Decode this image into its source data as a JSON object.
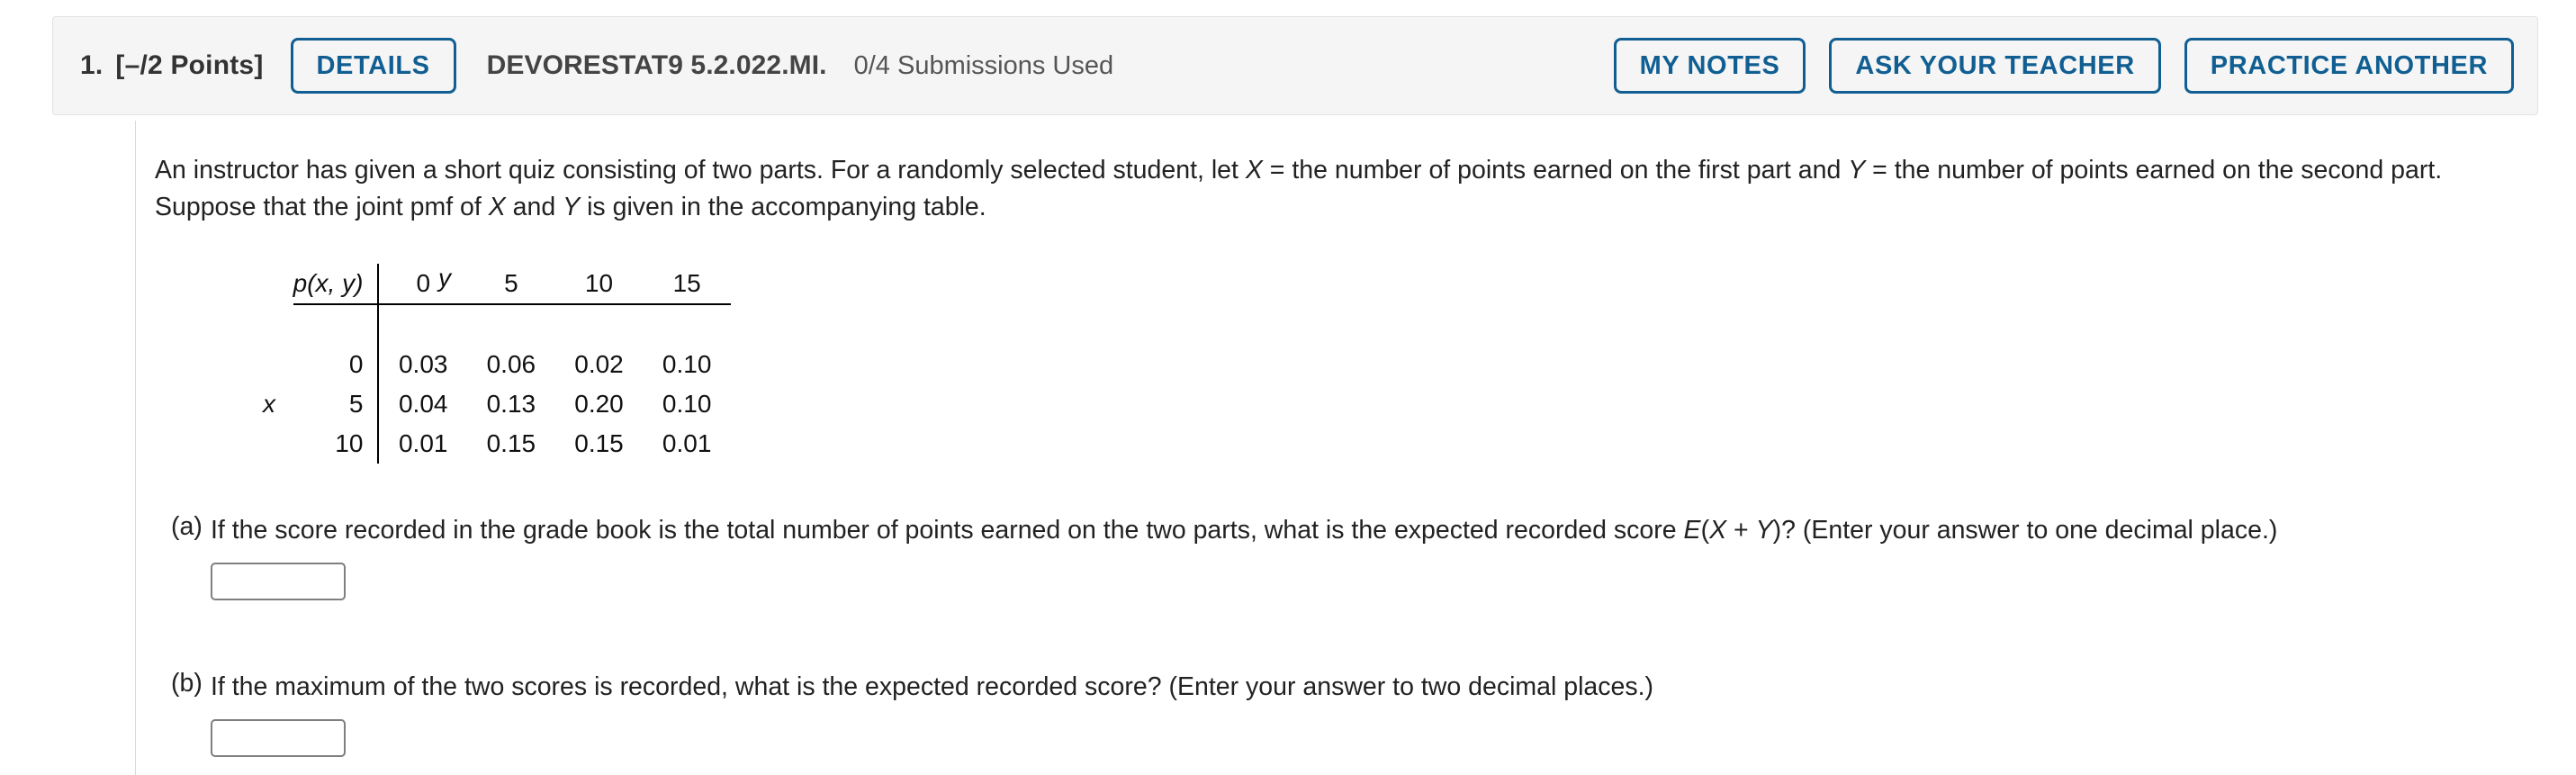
{
  "header": {
    "question_number": "1.",
    "points_label": "[–/2 Points]",
    "details_button": "DETAILS",
    "module_code": "DEVORESTAT9 5.2.022.MI.",
    "submissions_used": "0/4 Submissions Used",
    "my_notes_button": "MY NOTES",
    "ask_teacher_button": "ASK YOUR TEACHER",
    "practice_another_button": "PRACTICE ANOTHER",
    "accent_color": "#115f92",
    "background_color": "#f5f5f5"
  },
  "problem": {
    "text_part_1": "An instructor has given a short quiz consisting of two parts. For a randomly selected student, let ",
    "var_x_1": "X",
    "text_part_2": " = the number of points earned on the first part and ",
    "var_y_1": "Y",
    "text_part_3": " = the number of points earned on the second part. Suppose that the joint pmf of ",
    "var_x_2": "X",
    "text_part_4": " and ",
    "var_y_2": "Y",
    "text_part_5": " is given in the accompanying table."
  },
  "pmf_table": {
    "y_axis_label": "y",
    "x_axis_label": "x",
    "corner_label": "p(x, y)",
    "column_headers": [
      "0",
      "5",
      "10",
      "15"
    ],
    "row_headers": [
      "0",
      "5",
      "10"
    ],
    "values": [
      [
        "0.03",
        "0.06",
        "0.02",
        "0.10"
      ],
      [
        "0.04",
        "0.13",
        "0.20",
        "0.10"
      ],
      [
        "0.01",
        "0.15",
        "0.15",
        "0.01"
      ]
    ],
    "value_color": "#ff0000"
  },
  "parts": {
    "a": {
      "letter": "(a)",
      "text_1": "If the score recorded in the grade book is the total number of points earned on the two parts, what is the expected recorded score ",
      "expr_e": "E",
      "expr_paren_open": "(",
      "expr_x": "X",
      "expr_plus": " + ",
      "expr_y": "Y",
      "expr_paren_close": ")",
      "text_2": "? (Enter your answer to one decimal place.)",
      "input_value": "",
      "input_placeholder": ""
    },
    "b": {
      "letter": "(b)",
      "text_1": "If the maximum of the two scores is recorded, what is the expected recorded score? (Enter your answer to two decimal places.)",
      "input_value": "",
      "input_placeholder": ""
    }
  }
}
